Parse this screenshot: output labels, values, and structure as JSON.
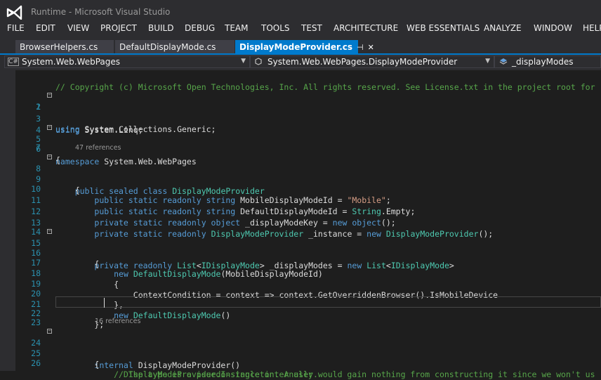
{
  "window": {
    "title": "Runtime - Microsoft Visual Studio"
  },
  "menu": [
    "FILE",
    "EDIT",
    "VIEW",
    "PROJECT",
    "BUILD",
    "DEBUG",
    "TEAM",
    "TOOLS",
    "TEST",
    "ARCHITECTURE",
    "WEB ESSENTIALS",
    "ANALYZE",
    "WINDOW",
    "HELP"
  ],
  "tabs": [
    {
      "label": "BrowserHelpers.cs",
      "active": false
    },
    {
      "label": "DefaultDisplayMode.cs",
      "active": false
    },
    {
      "label": "DisplayModeProvider.cs",
      "active": true,
      "pin": "⊣",
      "close": "✕"
    }
  ],
  "navbar": {
    "project": {
      "icon": "C#",
      "label": "System.Web.WebPages"
    },
    "type": {
      "label": "System.Web.WebPages.DisplayModeProvider"
    },
    "member": {
      "label": "_displayModes"
    }
  },
  "code": [
    {
      "n": "",
      "text": "// Copyright (c) Microsoft Open Technologies, Inc. All rights reserved. See License.txt in the project root for"
    },
    {
      "n": "1",
      "text": ""
    },
    {
      "n": "2",
      "text": "using System.Collections.Generic;"
    },
    {
      "n": "3",
      "text": "using System.Linq;"
    },
    {
      "n": "4",
      "text": ""
    },
    {
      "n": "5",
      "text": "namespace System.Web.WebPages"
    },
    {
      "n": "6",
      "text": "{"
    },
    {
      "n": "7",
      "ref": "47 references"
    },
    {
      "n": "8",
      "text": "    public sealed class DisplayModeProvider"
    },
    {
      "n": "9",
      "text": "    {"
    },
    {
      "n": "10",
      "text": "        public static readonly string MobileDisplayModeId = \"Mobile\";"
    },
    {
      "n": "11",
      "text": "        public static readonly string DefaultDisplayModeId = String.Empty;"
    },
    {
      "n": "12",
      "text": "        private static readonly object _displayModeKey = new object();"
    },
    {
      "n": "13",
      "text": "        private static readonly DisplayModeProvider _instance = new DisplayModeProvider();"
    },
    {
      "n": "14",
      "text": ""
    },
    {
      "n": "15",
      "text": "        private readonly List<IDisplayMode> _displayModes = new List<IDisplayMode>"
    },
    {
      "n": "16",
      "text": "        {"
    },
    {
      "n": "17",
      "text": "            new DefaultDisplayMode(MobileDisplayModeId)"
    },
    {
      "n": "18",
      "text": "            {"
    },
    {
      "n": "19",
      "text": "                ContextCondition = context => context.GetOverriddenBrowser().IsMobileDevice"
    },
    {
      "n": "20",
      "text": "            },"
    },
    {
      "n": "21",
      "text": "            new DefaultDisplayMode()"
    },
    {
      "n": "22",
      "text": "        };"
    },
    {
      "n": "23",
      "text": ""
    },
    {
      "n": "",
      "ref": "16 references"
    },
    {
      "n": "24",
      "text": "        internal DisplayModeProvider()"
    },
    {
      "n": "25",
      "text": "        {"
    },
    {
      "n": "26",
      "text": "            // The type is a psuedo-singleton. A user would gain nothing from constructing it since we won't us"
    },
    {
      "n": "",
      "text": "              DisplayModeProvider.Instance internally."
    }
  ],
  "colors": {
    "keyword": "#569cd6",
    "type": "#4ec9b0",
    "string": "#d69d85",
    "comment": "#57a64a",
    "line_number": "#2b91af",
    "accent": "#007acc",
    "plain": "#dcdcdc"
  }
}
